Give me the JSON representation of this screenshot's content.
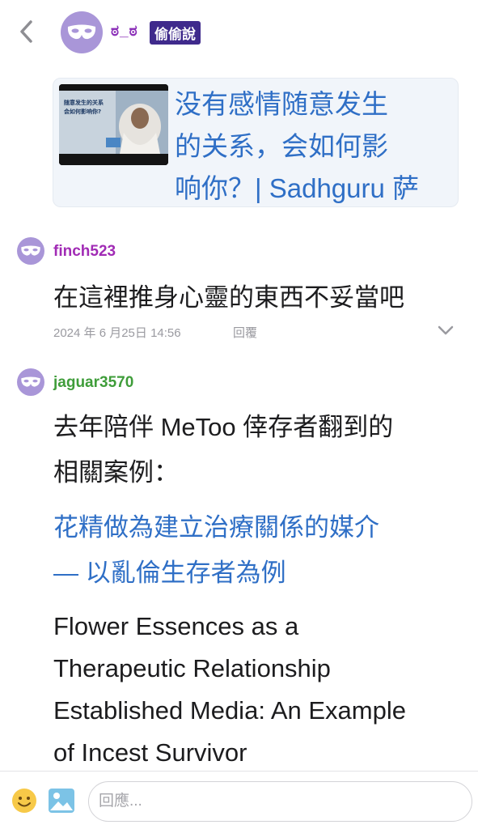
{
  "header": {
    "author_name": "ಠ_ಠ",
    "badge": "偷偷說"
  },
  "link_card": {
    "thumbnail_text": "随意发生的关系 会如何影响你?",
    "title_lines": [
      "没有感情随意发生",
      "的关系，会如何影",
      "响你？| Sadhguru 萨"
    ]
  },
  "comments": [
    {
      "username": "finch523",
      "username_color": "#a12bb5",
      "text": "在這裡推身心靈的東西不妥當吧",
      "date": "2024 年 6 月25日 14:56",
      "reply_label": "回覆"
    },
    {
      "username": "jaguar3570",
      "username_color": "#3f9d3a",
      "text_lines": [
        "去年陪伴 MeToo 倖存者翻到的",
        "相關案例："
      ],
      "link_lines": [
        "花精做為建立治療關係的媒介",
        "— 以亂倫生存者為例"
      ],
      "english_lines": [
        "Flower Essences as a",
        "Therapeutic Relationship",
        "Established Media: An Example",
        "of Incest Survivor"
      ]
    }
  ],
  "bottom_bar": {
    "placeholder": "回應..."
  },
  "colors": {
    "avatar": "#a996d8",
    "link": "#2f6fc6",
    "badge_bg": "#3f2a8c"
  },
  "icons": [
    "back-arrow-icon",
    "mask-icon",
    "chevron-down-icon",
    "emoji-icon",
    "image-icon"
  ]
}
